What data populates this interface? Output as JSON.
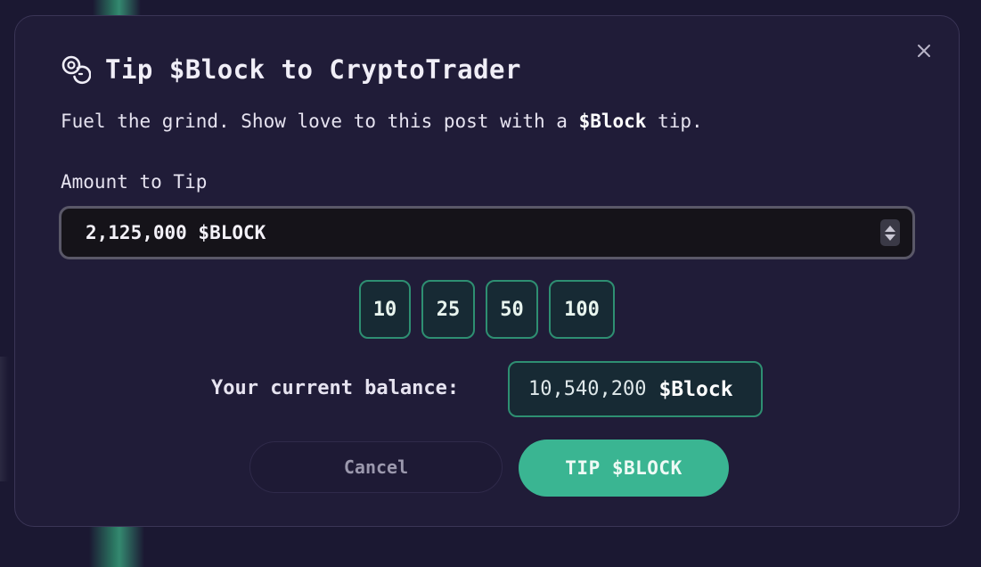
{
  "modal": {
    "title": "Tip $Block to CryptoTrader",
    "subtitle_before": "Fuel the grind. Show love to this post with a ",
    "subtitle_bold": "$Block",
    "subtitle_after": " tip.",
    "close_icon": "close-icon",
    "title_icon": "coins-icon"
  },
  "amount": {
    "label": "Amount to Tip",
    "value": "2,125,000 $BLOCK"
  },
  "presets": [
    "10",
    "25",
    "50",
    "100"
  ],
  "balance": {
    "label": "Your current balance:",
    "value": "10,540,200",
    "unit": "$Block"
  },
  "actions": {
    "cancel_label": "Cancel",
    "tip_label": "TIP $BLOCK"
  },
  "colors": {
    "accent": "#3ab592",
    "preset_border": "#2e8f72",
    "modal_bg": "#201c38"
  }
}
